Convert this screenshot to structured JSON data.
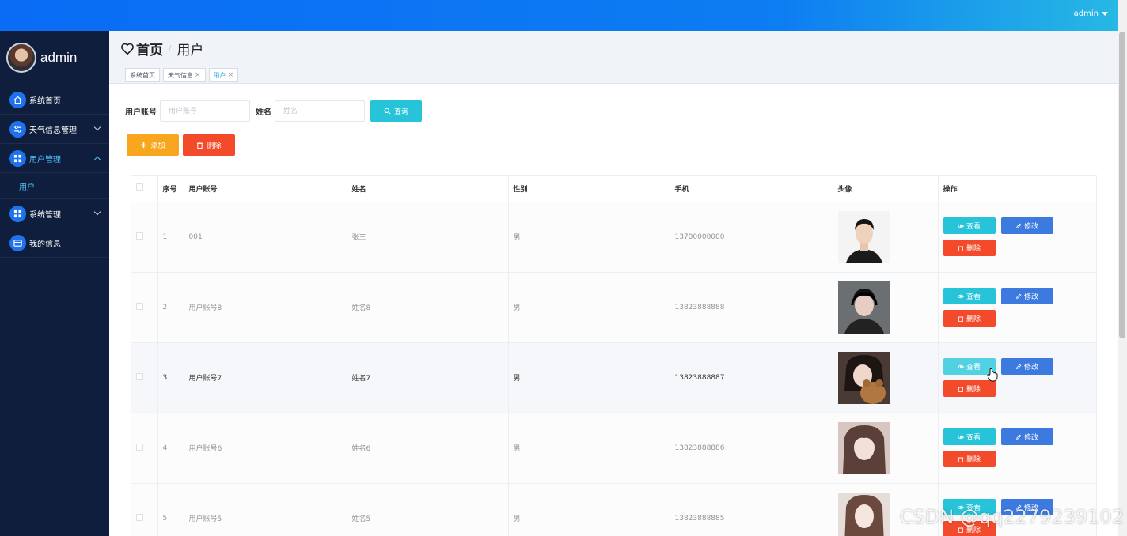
{
  "topbar": {
    "user": "admin"
  },
  "sidebar": {
    "brand": "admin",
    "items": [
      {
        "label": "系统首页",
        "icon": "home-icon"
      },
      {
        "label": "天气信息管理",
        "icon": "sliders-icon"
      },
      {
        "label": "用户管理",
        "icon": "grid-icon",
        "sub": "用户"
      },
      {
        "label": "系统管理",
        "icon": "grid-icon"
      },
      {
        "label": "我的信息",
        "icon": "card-icon"
      }
    ]
  },
  "breadcrumb": {
    "home": "首页",
    "separator": "/",
    "current": "用户"
  },
  "tags": [
    {
      "label": "系统首页"
    },
    {
      "label": "天气信息",
      "close": "×"
    },
    {
      "label": "用户",
      "close": "×"
    }
  ],
  "search": {
    "account_label": "用户账号",
    "account_placeholder": "用户账号",
    "name_label": "姓名",
    "name_placeholder": "姓名",
    "query_button": "查询"
  },
  "actions": {
    "add": "添加",
    "delete": "删除"
  },
  "table": {
    "headers": [
      "序号",
      "用户账号",
      "姓名",
      "性别",
      "手机",
      "头像",
      "操作"
    ],
    "rows": [
      {
        "index": "1",
        "account": "001",
        "name": "张三",
        "gender": "男",
        "phone": "13700000000"
      },
      {
        "index": "2",
        "account": "用户账号8",
        "name": "姓名8",
        "gender": "男",
        "phone": "13823888888"
      },
      {
        "index": "3",
        "account": "用户账号7",
        "name": "姓名7",
        "gender": "男",
        "phone": "13823888887"
      },
      {
        "index": "4",
        "account": "用户账号6",
        "name": "姓名6",
        "gender": "男",
        "phone": "13823888886"
      },
      {
        "index": "5",
        "account": "用户账号5",
        "name": "姓名5",
        "gender": "男",
        "phone": "13823888885"
      }
    ],
    "op_view": "查看",
    "op_edit": "修改",
    "op_delete": "删除"
  },
  "watermark": "CSDN @qq2279239102",
  "colors": {
    "topbar": "#0d7df2",
    "sidebar": "#0f1e3d",
    "accent": "#27c3d8",
    "danger": "#f24a2a",
    "warning": "#f7a61e",
    "primary": "#3d7ae0"
  }
}
